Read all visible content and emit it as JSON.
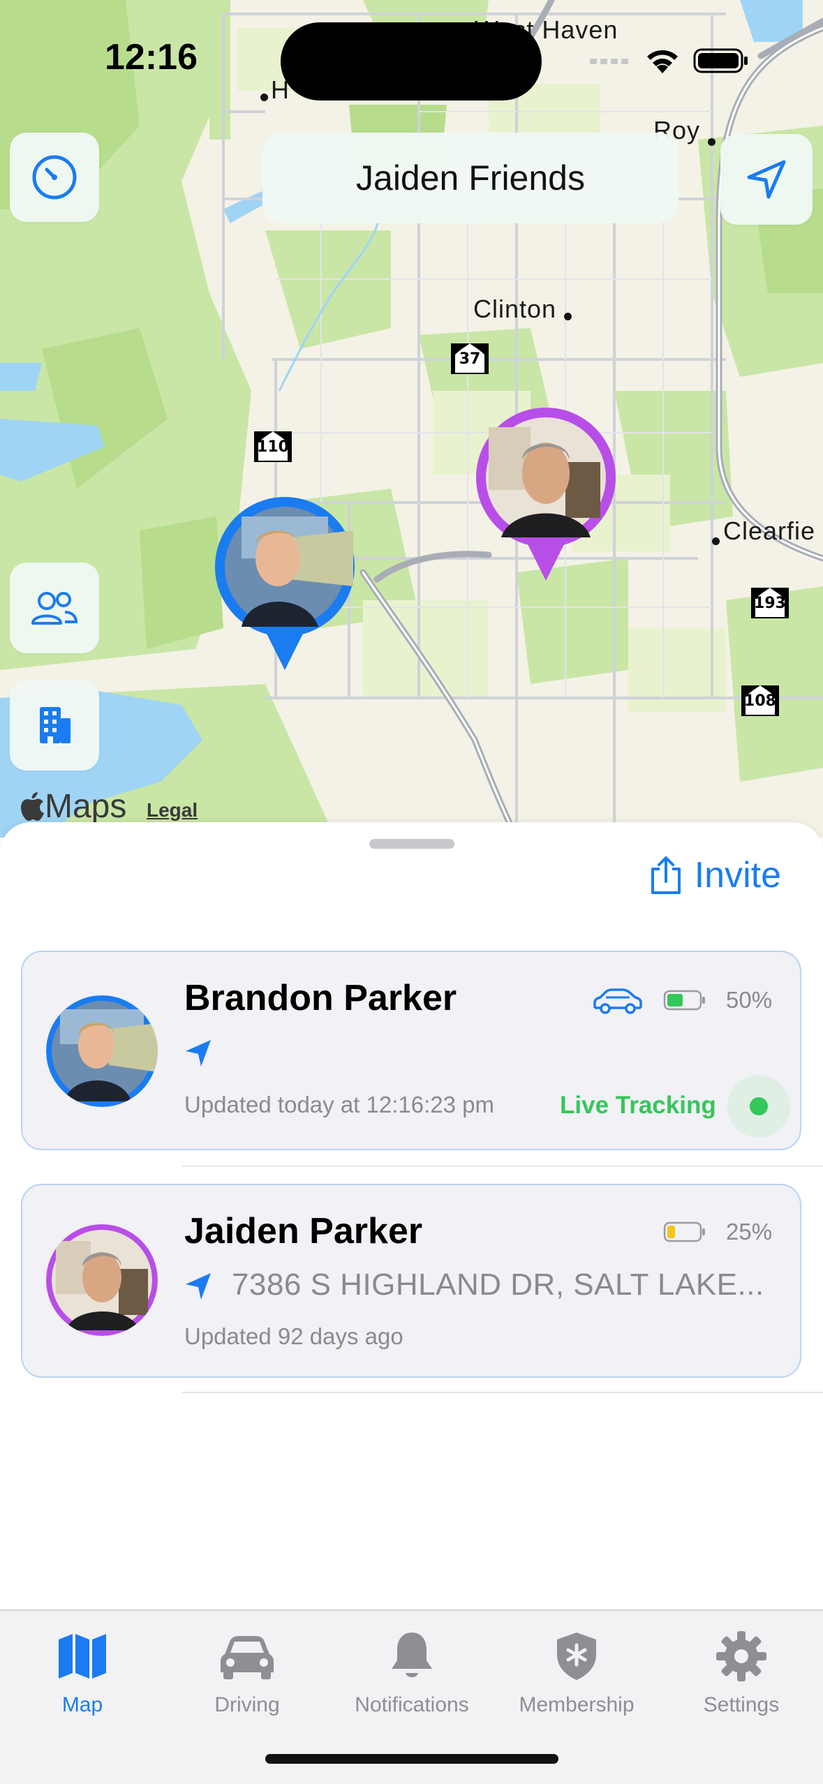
{
  "status_bar": {
    "time": "12:16"
  },
  "map": {
    "title": "Jaiden Friends",
    "places": {
      "west_haven": "West Haven",
      "h": "H",
      "roy": "Roy",
      "clinton": "Clinton",
      "clearfield": "Clearfie"
    },
    "shields": {
      "s37": "37",
      "s110": "110",
      "s193": "193",
      "s108": "108"
    },
    "attribution": {
      "brand": "Maps",
      "legal": "Legal"
    }
  },
  "sheet": {
    "invite_label": "Invite",
    "members": [
      {
        "name": "Brandon Parker",
        "battery": "50%",
        "updated": "Updated today at 12:16:23 pm",
        "status": "Live Tracking",
        "ring_color": "#1a7cf0"
      },
      {
        "name": "Jaiden Parker",
        "battery": "25%",
        "address": "7386 S HIGHLAND DR, SALT LAKE...",
        "updated": "Updated 92 days ago",
        "ring_color": "#b84ee8"
      }
    ]
  },
  "tabbar": {
    "items": [
      {
        "label": "Map",
        "icon": "map-icon",
        "active": true
      },
      {
        "label": "Driving",
        "icon": "car-icon"
      },
      {
        "label": "Notifications",
        "icon": "bell-icon"
      },
      {
        "label": "Membership",
        "icon": "shield-star-icon"
      },
      {
        "label": "Settings",
        "icon": "gear-icon"
      }
    ]
  },
  "colors": {
    "accent": "#1a7cf0",
    "live": "#34c759",
    "purple": "#b84ee8"
  }
}
